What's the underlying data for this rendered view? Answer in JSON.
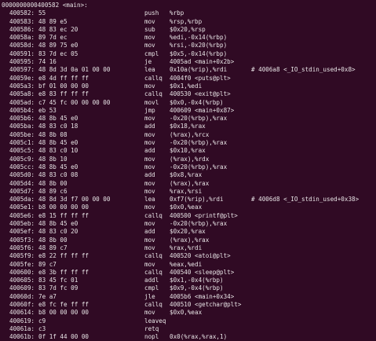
{
  "header": "0000000000400582 <main>:",
  "lines": [
    {
      "addr": "400582:",
      "bytes": "55",
      "mnem": "push",
      "ops": "%rbp",
      "cmt": ""
    },
    {
      "addr": "400583:",
      "bytes": "48 89 e5",
      "mnem": "mov",
      "ops": "%rsp,%rbp",
      "cmt": ""
    },
    {
      "addr": "400586:",
      "bytes": "48 83 ec 20",
      "mnem": "sub",
      "ops": "$0x20,%rsp",
      "cmt": ""
    },
    {
      "addr": "40058a:",
      "bytes": "89 7d ec",
      "mnem": "mov",
      "ops": "%edi,-0x14(%rbp)",
      "cmt": ""
    },
    {
      "addr": "40058d:",
      "bytes": "48 89 75 e0",
      "mnem": "mov",
      "ops": "%rsi,-0x20(%rbp)",
      "cmt": ""
    },
    {
      "addr": "400591:",
      "bytes": "83 7d ec 05",
      "mnem": "cmpl",
      "ops": "$0x5,-0x14(%rbp)",
      "cmt": ""
    },
    {
      "addr": "400595:",
      "bytes": "74 16",
      "mnem": "je",
      "ops": "4005ad <main+0x2b>",
      "cmt": ""
    },
    {
      "addr": "400597:",
      "bytes": "48 8d 3d 0a 01 00 00",
      "mnem": "lea",
      "ops": "0x10a(%rip),%rdi",
      "cmt": "# 4006a8 <_IO_stdin_used+0x8>"
    },
    {
      "addr": "40059e:",
      "bytes": "e8 4d ff ff ff",
      "mnem": "callq",
      "ops": "4004f0 <puts@plt>",
      "cmt": ""
    },
    {
      "addr": "4005a3:",
      "bytes": "bf 01 00 00 00",
      "mnem": "mov",
      "ops": "$0x1,%edi",
      "cmt": ""
    },
    {
      "addr": "4005a8:",
      "bytes": "e8 83 ff ff ff",
      "mnem": "callq",
      "ops": "400530 <exit@plt>",
      "cmt": ""
    },
    {
      "addr": "4005ad:",
      "bytes": "c7 45 fc 00 00 00 00",
      "mnem": "movl",
      "ops": "$0x0,-0x4(%rbp)",
      "cmt": ""
    },
    {
      "addr": "4005b4:",
      "bytes": "eb 53",
      "mnem": "jmp",
      "ops": "400609 <main+0x87>",
      "cmt": ""
    },
    {
      "addr": "4005b6:",
      "bytes": "48 8b 45 e0",
      "mnem": "mov",
      "ops": "-0x20(%rbp),%rax",
      "cmt": ""
    },
    {
      "addr": "4005ba:",
      "bytes": "48 83 c0 18",
      "mnem": "add",
      "ops": "$0x18,%rax",
      "cmt": ""
    },
    {
      "addr": "4005be:",
      "bytes": "48 8b 08",
      "mnem": "mov",
      "ops": "(%rax),%rcx",
      "cmt": ""
    },
    {
      "addr": "4005c1:",
      "bytes": "48 8b 45 e0",
      "mnem": "mov",
      "ops": "-0x20(%rbp),%rax",
      "cmt": ""
    },
    {
      "addr": "4005c5:",
      "bytes": "48 83 c0 10",
      "mnem": "add",
      "ops": "$0x10,%rax",
      "cmt": ""
    },
    {
      "addr": "4005c9:",
      "bytes": "48 8b 10",
      "mnem": "mov",
      "ops": "(%rax),%rdx",
      "cmt": ""
    },
    {
      "addr": "4005cc:",
      "bytes": "48 8b 45 e0",
      "mnem": "mov",
      "ops": "-0x20(%rbp),%rax",
      "cmt": ""
    },
    {
      "addr": "4005d0:",
      "bytes": "48 83 c0 08",
      "mnem": "add",
      "ops": "$0x8,%rax",
      "cmt": ""
    },
    {
      "addr": "4005d4:",
      "bytes": "48 8b 00",
      "mnem": "mov",
      "ops": "(%rax),%rax",
      "cmt": ""
    },
    {
      "addr": "4005d7:",
      "bytes": "48 89 c6",
      "mnem": "mov",
      "ops": "%rax,%rsi",
      "cmt": ""
    },
    {
      "addr": "4005da:",
      "bytes": "48 8d 3d f7 00 00 00",
      "mnem": "lea",
      "ops": "0xf7(%rip),%rdi",
      "cmt": "# 4006d8 <_IO_stdin_used+0x38>"
    },
    {
      "addr": "4005e1:",
      "bytes": "b8 00 00 00 00",
      "mnem": "mov",
      "ops": "$0x0,%eax",
      "cmt": ""
    },
    {
      "addr": "4005e6:",
      "bytes": "e8 15 ff ff ff",
      "mnem": "callq",
      "ops": "400500 <printf@plt>",
      "cmt": ""
    },
    {
      "addr": "4005eb:",
      "bytes": "48 8b 45 e0",
      "mnem": "mov",
      "ops": "-0x20(%rbp),%rax",
      "cmt": ""
    },
    {
      "addr": "4005ef:",
      "bytes": "48 83 c0 20",
      "mnem": "add",
      "ops": "$0x20,%rax",
      "cmt": ""
    },
    {
      "addr": "4005f3:",
      "bytes": "48 8b 00",
      "mnem": "mov",
      "ops": "(%rax),%rax",
      "cmt": ""
    },
    {
      "addr": "4005f6:",
      "bytes": "48 89 c7",
      "mnem": "mov",
      "ops": "%rax,%rdi",
      "cmt": ""
    },
    {
      "addr": "4005f9:",
      "bytes": "e8 22 ff ff ff",
      "mnem": "callq",
      "ops": "400520 <atoi@plt>",
      "cmt": ""
    },
    {
      "addr": "4005fe:",
      "bytes": "89 c7",
      "mnem": "mov",
      "ops": "%eax,%edi",
      "cmt": ""
    },
    {
      "addr": "400600:",
      "bytes": "e8 3b ff ff ff",
      "mnem": "callq",
      "ops": "400540 <sleep@plt>",
      "cmt": ""
    },
    {
      "addr": "400605:",
      "bytes": "83 45 fc 01",
      "mnem": "addl",
      "ops": "$0x1,-0x4(%rbp)",
      "cmt": ""
    },
    {
      "addr": "400609:",
      "bytes": "83 7d fc 09",
      "mnem": "cmpl",
      "ops": "$0x9,-0x4(%rbp)",
      "cmt": ""
    },
    {
      "addr": "40060d:",
      "bytes": "7e a7",
      "mnem": "jle",
      "ops": "4005b6 <main+0x34>",
      "cmt": ""
    },
    {
      "addr": "40060f:",
      "bytes": "e8 fc fe ff ff",
      "mnem": "callq",
      "ops": "400510 <getchar@plt>",
      "cmt": ""
    },
    {
      "addr": "400614:",
      "bytes": "b8 00 00 00 00",
      "mnem": "mov",
      "ops": "$0x0,%eax",
      "cmt": ""
    },
    {
      "addr": "400619:",
      "bytes": "c9",
      "mnem": "leaveq",
      "ops": "",
      "cmt": ""
    },
    {
      "addr": "40061a:",
      "bytes": "c3",
      "mnem": "retq",
      "ops": "",
      "cmt": ""
    },
    {
      "addr": "40061b:",
      "bytes": "0f 1f 44 00 00",
      "mnem": "nopl",
      "ops": "0x0(%rax,%rax,1)",
      "cmt": ""
    }
  ]
}
